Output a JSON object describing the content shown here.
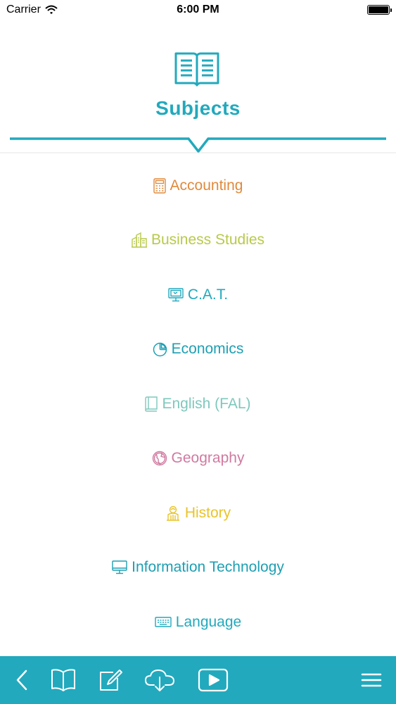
{
  "status_bar": {
    "carrier": "Carrier",
    "time": "6:00 PM",
    "wifi_icon": "wifi-icon",
    "battery_icon": "battery-icon"
  },
  "header": {
    "title": "Subjects",
    "icon": "open-book-icon"
  },
  "colors": {
    "brand": "#22a9bd",
    "accounting": "#e08a3c",
    "business": "#b9c94a",
    "cat": "#22a9bd",
    "economics": "#1d9fb3",
    "english": "#7ec8bd",
    "geography": "#d07aa0",
    "history": "#e8c42a",
    "it": "#1d9fb3",
    "language": "#22a9bd"
  },
  "subjects": [
    {
      "label": "Accounting",
      "icon": "calculator-icon"
    },
    {
      "label": "Business Studies",
      "icon": "buildings-icon"
    },
    {
      "label": "C.A.T.",
      "icon": "computer-screen-icon"
    },
    {
      "label": "Economics",
      "icon": "pie-chart-icon"
    },
    {
      "label": "English (FAL)",
      "icon": "book-icon"
    },
    {
      "label": "Geography",
      "icon": "globe-icon"
    },
    {
      "label": "History",
      "icon": "monument-icon"
    },
    {
      "label": "Information Technology",
      "icon": "monitor-icon"
    },
    {
      "label": "Language",
      "icon": "keyboard-icon"
    }
  ],
  "toolbar": {
    "back": "back-chevron-icon",
    "library": "open-book-icon",
    "notes": "edit-note-icon",
    "download": "cloud-download-icon",
    "video": "play-video-icon",
    "menu": "hamburger-menu-icon"
  }
}
